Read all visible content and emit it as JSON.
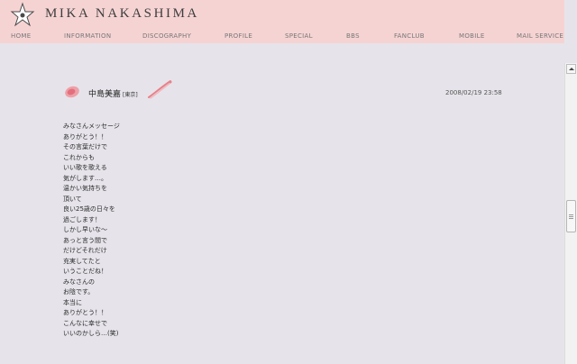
{
  "header": {
    "title": "MIKA NAKASHIMA",
    "nav": [
      {
        "label": "HOME"
      },
      {
        "label": "INFORMATION"
      },
      {
        "label": "DISCOGRAPHY"
      },
      {
        "label": "PROFILE"
      },
      {
        "label": "SPECIAL"
      },
      {
        "label": "BBS"
      },
      {
        "label": "FANCLUB"
      },
      {
        "label": "MOBILE"
      },
      {
        "label": "MAIL SERVICE"
      }
    ]
  },
  "post": {
    "author": "中島美嘉",
    "location": "[東京]",
    "timestamp": "2008/02/19 23:58",
    "lines": [
      "みなさんメッセージ",
      "ありがとう！！",
      "その言葉だけで",
      "これからも",
      "いい歌を歌える",
      "気がします…。",
      "温かい気持ちを",
      "頂いて",
      "良い25歳の日々を",
      "過ごします！",
      "しかし早いな〜",
      "あっと言う間で",
      "だけどそれだけ",
      "充実してたと",
      "いうことだね！",
      "みなさんの",
      "お陰です。",
      "本当に",
      "ありがとう！！",
      "こんなに幸せで",
      "いいのかしら…(笑)"
    ]
  },
  "colors": {
    "header_bg": "#f6d3d3",
    "page_bg": "#e6e4ea",
    "accent_pink": "#e8808a"
  }
}
